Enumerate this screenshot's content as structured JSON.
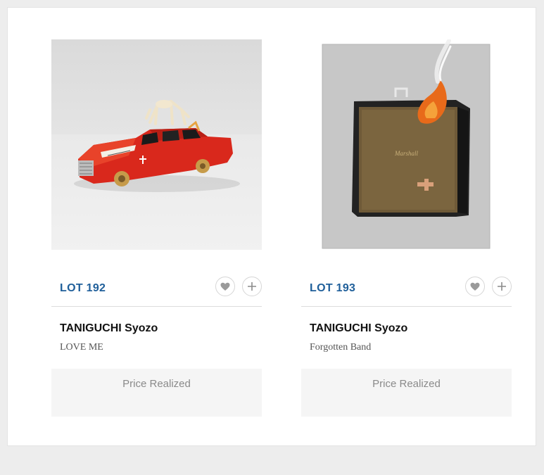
{
  "lots": [
    {
      "lot_label": "LOT 192",
      "artist": "TANIGUCHI Syozo",
      "title": "LOVE ME",
      "price_label": "Price Realized",
      "image_alt": "red car sculpture"
    },
    {
      "lot_label": "LOT 193",
      "artist": "TANIGUCHI Syozo",
      "title": "Forgotten Band",
      "price_label": "Price Realized",
      "image_alt": "painting of amplifier on fire"
    }
  ],
  "icons": {
    "favorite": "heart-icon",
    "add": "plus-icon"
  },
  "colors": {
    "accent": "#1f5f9a",
    "price_bg": "#f5f5f5"
  }
}
